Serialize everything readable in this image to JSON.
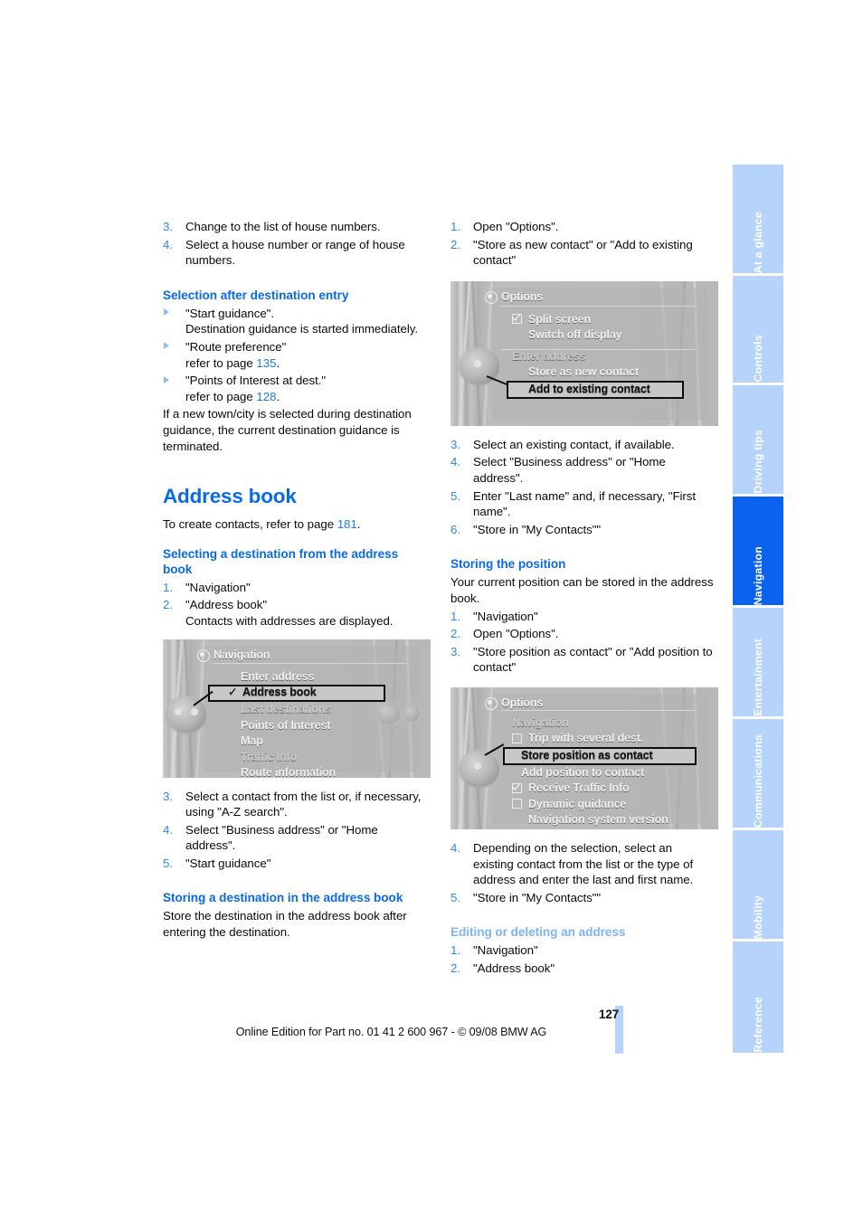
{
  "page": {
    "number": "127",
    "imprint": "Online Edition for Part no. 01 41 2 600 967  - © 09/08 BMW AG"
  },
  "left_column": {
    "steps_top": [
      {
        "num": "3.",
        "text": "Change to the list of house numbers."
      },
      {
        "num": "4.",
        "text": "Select a house number or range of house numbers."
      }
    ],
    "heading_selection": "Selection after destination entry",
    "arrow_items": [
      {
        "text": "\"Start guidance\".",
        "text2": "Destination guidance is started immediately."
      },
      {
        "text": "\"Route preference\"",
        "text2": "refer to page ",
        "page": "135",
        "tail": "."
      },
      {
        "text": "\"Points of Interest at dest.\"",
        "text2": "refer to page ",
        "page": "128",
        "tail": "."
      }
    ],
    "note": "If a new town/city is selected during destination guidance, the current destination guidance is terminated.",
    "heading_address_book": "Address book",
    "create_contacts_pre": "To create contacts, refer to page ",
    "create_contacts_page": "181",
    "create_contacts_post": ".",
    "heading_selecting": "Selecting a destination from the address book",
    "steps_selecting": [
      {
        "num": "1.",
        "text": "\"Navigation\""
      },
      {
        "num": "2.",
        "text": "\"Address book\"",
        "text2": "Contacts with addresses are displayed."
      }
    ],
    "steps_after_figure": [
      {
        "num": "3.",
        "text": "Select a contact from the list or, if necessary, using \"A-Z search\"."
      },
      {
        "num": "4.",
        "text": "Select \"Business address\" or \"Home address\"."
      },
      {
        "num": "5.",
        "text": "\"Start guidance\""
      }
    ],
    "heading_storing_dest": "Storing a destination in the address book",
    "storing_dest_note": "Store the destination in the address book after entering the destination."
  },
  "right_column": {
    "steps_top": [
      {
        "num": "1.",
        "text": "Open \"Options\"."
      },
      {
        "num": "2.",
        "text": "\"Store as new contact\" or \"Add to existing contact\""
      }
    ],
    "steps_after_options": [
      {
        "num": "3.",
        "text": "Select an existing contact, if available."
      },
      {
        "num": "4.",
        "text": "Select \"Business address\" or \"Home address\"."
      },
      {
        "num": "5.",
        "text": "Enter \"Last name\" and, if necessary, \"First name\"."
      },
      {
        "num": "6.",
        "text": "\"Store in \"My Contacts\"\""
      }
    ],
    "heading_storing_position": "Storing the position",
    "storing_position_note": "Your current position can be stored in the address book.",
    "steps_position": [
      {
        "num": "1.",
        "text": "\"Navigation\""
      },
      {
        "num": "2.",
        "text": "Open \"Options\"."
      },
      {
        "num": "3.",
        "text": "\"Store position as contact\" or \"Add position to contact\""
      }
    ],
    "steps_position_after": [
      {
        "num": "4.",
        "text": "Depending on the selection, select an existing contact from the list or the type of address and enter the last and first name."
      },
      {
        "num": "5.",
        "text": "\"Store in \"My Contacts\"\""
      }
    ],
    "heading_editing": "Editing or deleting an address",
    "steps_editing": [
      {
        "num": "1.",
        "text": "\"Navigation\""
      },
      {
        "num": "2.",
        "text": "\"Address book\""
      }
    ]
  },
  "figures": {
    "navigation_menu": {
      "title": "Navigation",
      "items": [
        {
          "label": "Enter address",
          "selected": false,
          "checked": false
        },
        {
          "label": "Address book",
          "selected": true,
          "checked": true
        },
        {
          "label": "Last destinations",
          "selected": false,
          "checked": false
        },
        {
          "label": "Points of Interest",
          "selected": false,
          "checked": false
        },
        {
          "label": "Map",
          "selected": false,
          "checked": false
        },
        {
          "label": "Traffic Info",
          "selected": false,
          "checked": false
        },
        {
          "label": "Route information",
          "selected": false,
          "checked": false
        }
      ]
    },
    "options_contact": {
      "title": "Options",
      "items": [
        {
          "label": "Split screen",
          "box": "checked",
          "selected": false
        },
        {
          "label": "Switch off display",
          "box": "none",
          "selected": false
        },
        {
          "label": "Enter address",
          "box": "none",
          "selected": false,
          "dim": true
        },
        {
          "label": "Store as new contact",
          "box": "none",
          "selected": false
        },
        {
          "label": "Add to existing contact",
          "box": "none",
          "selected": true
        }
      ]
    },
    "options_position": {
      "title": "Options",
      "items": [
        {
          "label": "Navigation",
          "box": "none",
          "selected": false,
          "dim": true
        },
        {
          "label": "Trip with several dest.",
          "box": "empty",
          "selected": false
        },
        {
          "label": "Store position as contact",
          "box": "none",
          "selected": true
        },
        {
          "label": "Add position to contact",
          "box": "none",
          "selected": false
        },
        {
          "label": "Receive Traffic Info",
          "box": "checked",
          "selected": false
        },
        {
          "label": "Dynamic guidance",
          "box": "empty",
          "selected": false
        },
        {
          "label": "Navigation system version",
          "box": "none",
          "selected": false
        }
      ]
    }
  },
  "sidebar": {
    "tabs": [
      {
        "label": "At a glance",
        "active": false
      },
      {
        "label": "Controls",
        "active": false
      },
      {
        "label": "Driving tips",
        "active": false
      },
      {
        "label": "Navigation",
        "active": true
      },
      {
        "label": "Entertainment",
        "active": false
      },
      {
        "label": "Communications",
        "active": false
      },
      {
        "label": "Mobility",
        "active": false
      },
      {
        "label": "Reference",
        "active": false
      }
    ]
  },
  "colors": {
    "heading_blue": "#0a6ae8",
    "number_blue": "#2f86ee",
    "faded_blue": "#7fb3f4",
    "tab_blue": "#b5d3fb",
    "tab_active_blue": "#0a62ef"
  }
}
